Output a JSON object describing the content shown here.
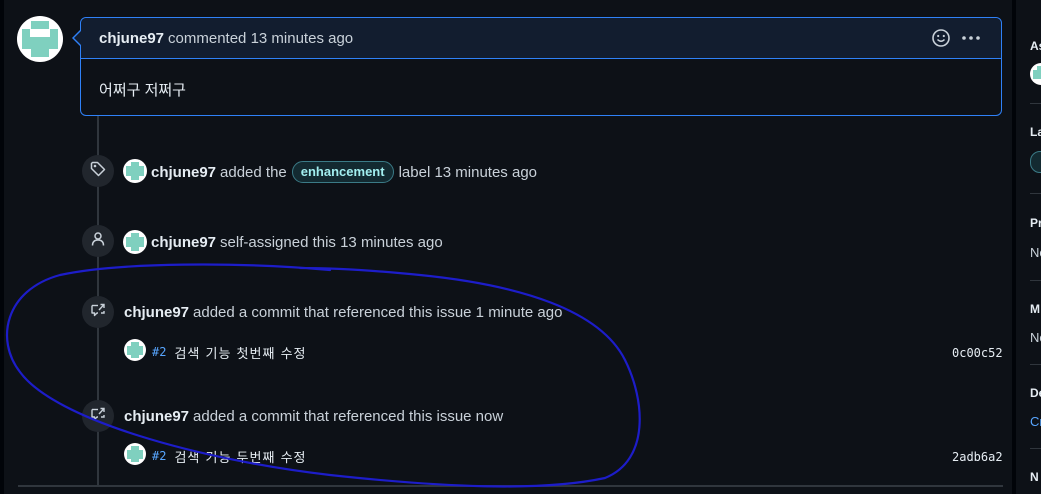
{
  "comment": {
    "author": "chjune97",
    "meta": "commented 13 minutes ago",
    "body": "어쩌구 저쩌구",
    "icons": [
      "smiley-icon",
      "kebab-horizontal-icon"
    ]
  },
  "timeline": {
    "label_event": {
      "author": "chjune97",
      "text_before": "added the",
      "label": "enhancement",
      "text_after": "label 13 minutes ago",
      "icon": "tag-icon"
    },
    "assign_event": {
      "author": "chjune97",
      "text": "self-assigned this 13 minutes ago",
      "icon": "person-icon"
    },
    "commit_events": [
      {
        "author": "chjune97",
        "text": "added a commit that referenced this issue 1 minute ago",
        "icon": "cross-reference-icon",
        "commit": {
          "number": "#2",
          "message": "검색 기능 첫번째 수정",
          "sha": "0c00c52"
        }
      },
      {
        "author": "chjune97",
        "text": "added a commit that referenced this issue now",
        "icon": "cross-reference-icon",
        "commit": {
          "number": "#2",
          "message": "검색 기능 두번째 수정",
          "sha": "2adb6a2"
        }
      }
    ]
  },
  "sidebar": {
    "headings": [
      "As",
      "La",
      "Pr",
      "M",
      "De",
      "N"
    ],
    "values": [
      "No",
      "No",
      "Cr"
    ]
  },
  "colors": {
    "accent": "#2f81f7",
    "label_fg": "#a2eeef",
    "annotation": "#1d1dc9"
  }
}
